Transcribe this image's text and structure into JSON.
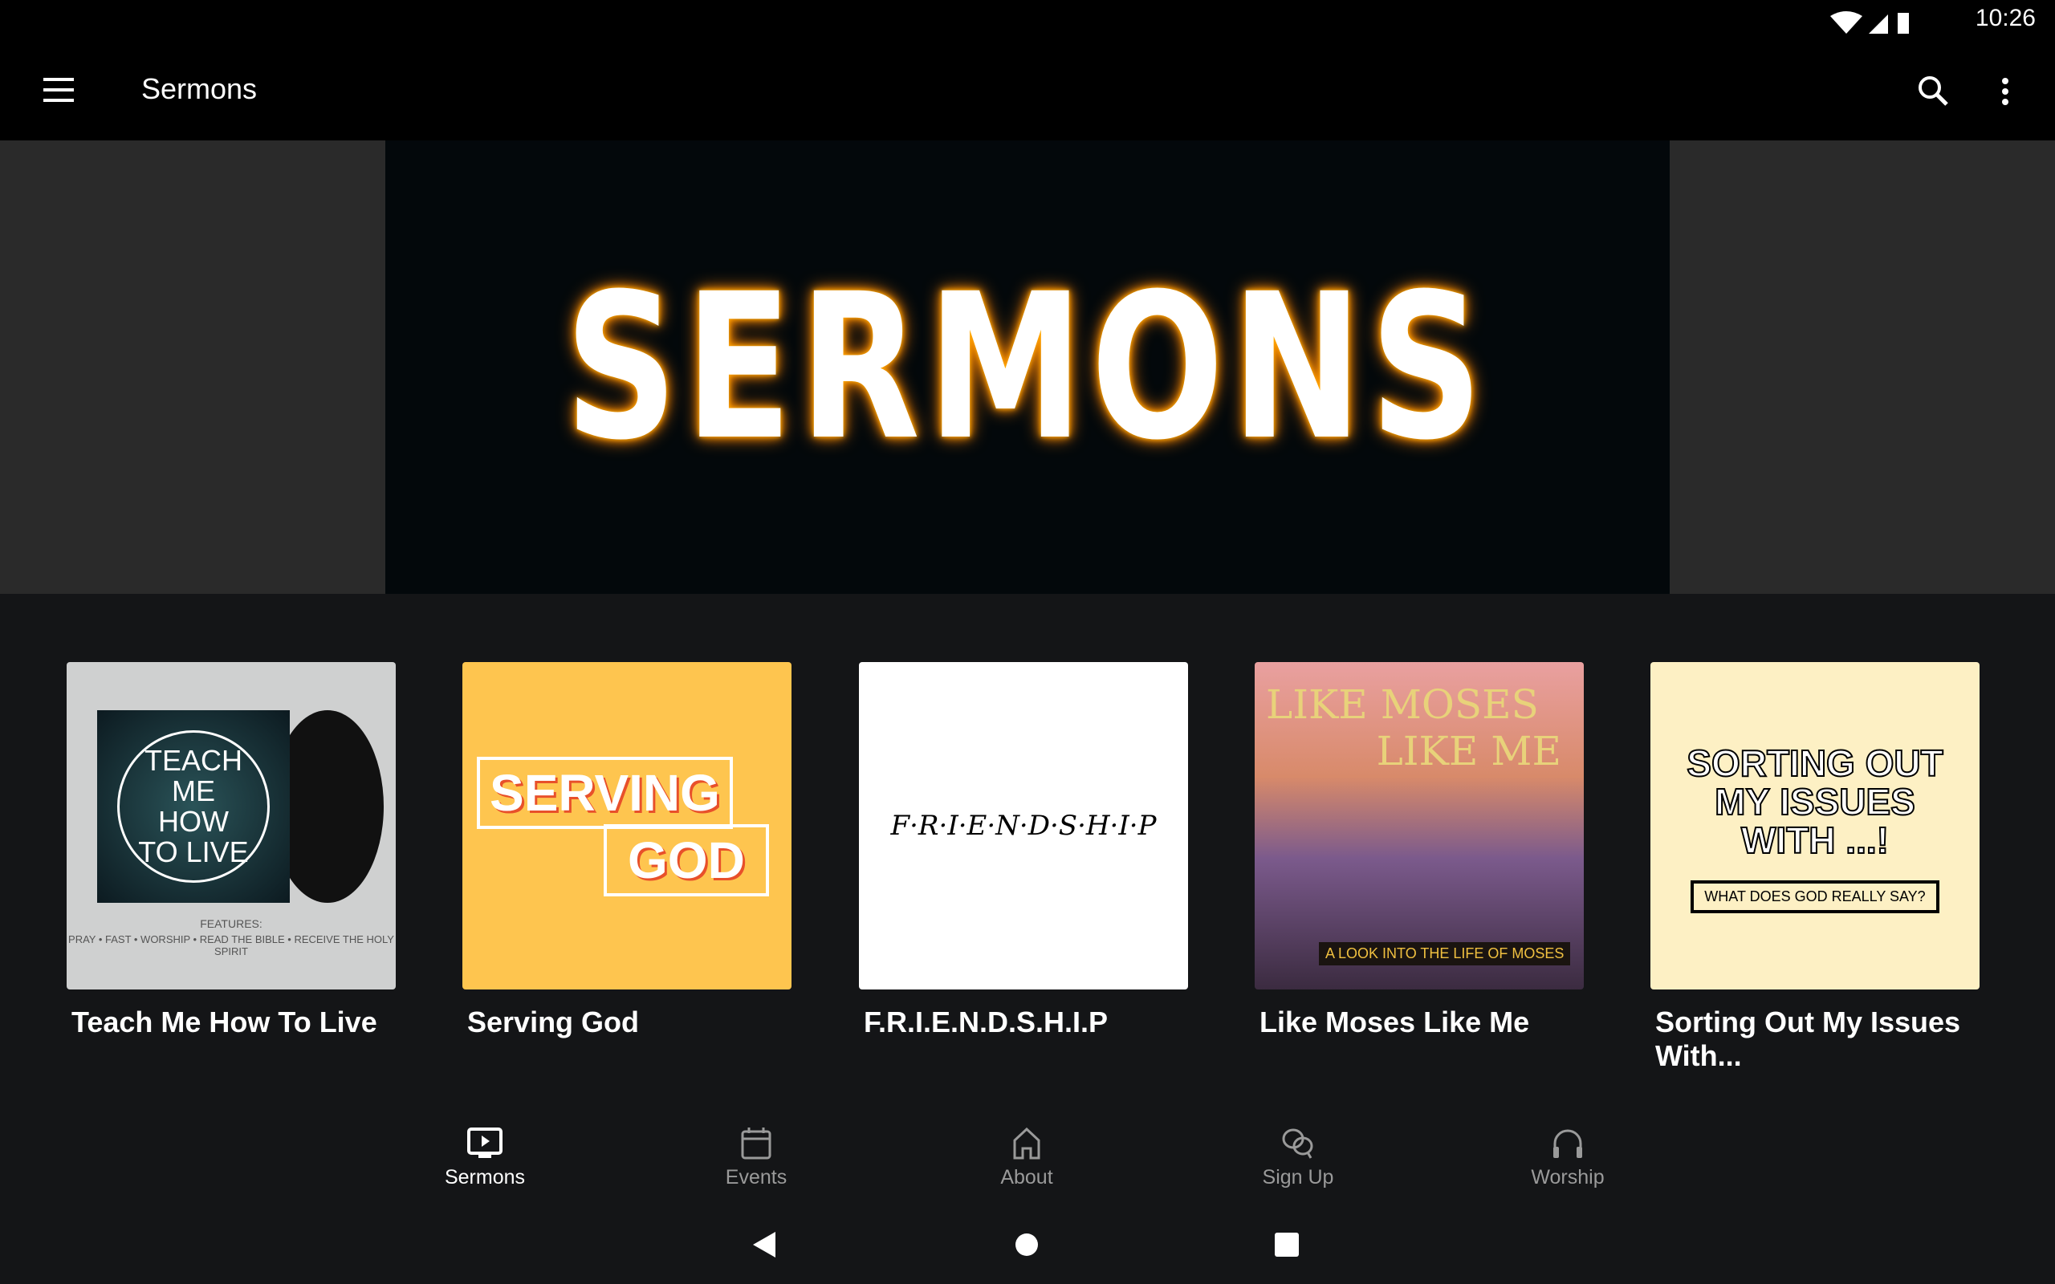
{
  "status": {
    "time": "10:26"
  },
  "appbar": {
    "title": "Sermons"
  },
  "banner": {
    "text": "SERMONS"
  },
  "cards": [
    {
      "title": "Teach Me How To Live",
      "art_text": "TEACH ME HOW TO LIVE",
      "art_sub": "FEATURES:",
      "art_sub2": "PRAY • FAST • WORSHIP • READ THE BIBLE • RECEIVE THE HOLY SPIRIT"
    },
    {
      "title": "Serving God",
      "art_text": "SERVING",
      "art_text2": "GOD"
    },
    {
      "title": "F.R.I.E.N.D.S.H.I.P",
      "art_text": "F·R·I·E·N·D·S·H·I·P"
    },
    {
      "title": "Like Moses Like Me",
      "art_text": "LIKE MOSES",
      "art_text2": "LIKE ME",
      "art_sub": "A LOOK INTO THE LIFE OF MOSES"
    },
    {
      "title": "Sorting Out My Issues With...",
      "art_text": "SORTING OUT MY ISSUES WITH ...!",
      "art_sub": "WHAT DOES GOD REALLY SAY?"
    }
  ],
  "nav": [
    {
      "label": "Sermons",
      "icon": "tv-play-icon",
      "active": true
    },
    {
      "label": "Events",
      "icon": "calendar-icon"
    },
    {
      "label": "About",
      "icon": "home-icon"
    },
    {
      "label": "Sign Up",
      "icon": "chat-icon"
    },
    {
      "label": "Worship",
      "icon": "headphones-icon"
    }
  ],
  "colors": {
    "background": "#141517",
    "accent_glow": "#ff9500",
    "serving_god_bg": "#fec54f",
    "sorting_bg": "#fdf0c4"
  }
}
